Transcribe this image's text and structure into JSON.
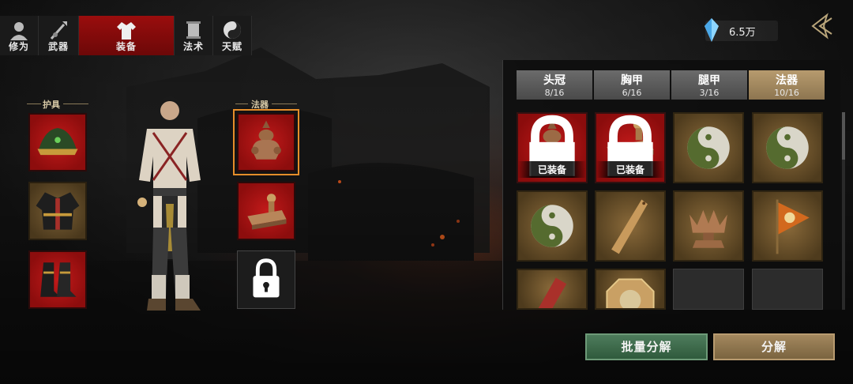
{
  "top_tabs": [
    {
      "label": "修为",
      "icon": "portrait-icon",
      "active": false
    },
    {
      "label": "武器",
      "icon": "spear-icon",
      "active": false
    },
    {
      "label": "装备",
      "icon": "robe-icon",
      "active": true
    },
    {
      "label": "法术",
      "icon": "scroll-icon",
      "active": false
    },
    {
      "label": "天赋",
      "icon": "yin-yang-icon",
      "active": false
    }
  ],
  "currency": {
    "icon": "crystal-icon",
    "value": "6.5万"
  },
  "left_section": {
    "armor_label": "护具",
    "artifact_label": "法器",
    "armor_slots": [
      "hat-icon",
      "armor-coat-icon",
      "boots-icon"
    ],
    "artifact_slots": [
      "bronze-vessel-icon",
      "seal-stamp-icon",
      "lock-icon"
    ]
  },
  "categories": [
    {
      "name": "头冠",
      "count": "8/16",
      "active": false
    },
    {
      "name": "胸甲",
      "count": "6/16",
      "active": false
    },
    {
      "name": "腿甲",
      "count": "3/16",
      "active": false
    },
    {
      "name": "法器",
      "count": "10/16",
      "active": true
    }
  ],
  "items": [
    {
      "icon": "bronze-vessel-icon",
      "style": "red",
      "equipped_label": "已装备"
    },
    {
      "icon": "seal-stamp-icon",
      "style": "red",
      "equipped_label": "已装备"
    },
    {
      "icon": "yin-yang-icon",
      "style": "gold"
    },
    {
      "icon": "yin-yang-icon",
      "style": "gold"
    },
    {
      "icon": "yin-yang-icon",
      "style": "gold"
    },
    {
      "icon": "wooden-ruler-icon",
      "style": "gold"
    },
    {
      "icon": "lotus-censer-icon",
      "style": "gold"
    },
    {
      "icon": "bagua-flag-icon",
      "style": "gold"
    },
    {
      "icon": "red-talisman-icon",
      "style": "gold"
    },
    {
      "icon": "bagua-mirror-icon",
      "style": "gold"
    },
    {
      "icon": "empty-slot",
      "style": "empty"
    },
    {
      "icon": "empty-slot",
      "style": "empty"
    }
  ],
  "buttons": {
    "batch_decompose": "批量分解",
    "decompose": "分解"
  },
  "colors": {
    "active_tab": "#9a0d0d",
    "selected_outline": "#e58d2a",
    "green_button": "#2f5a3c",
    "tan_button": "#7a6440"
  }
}
